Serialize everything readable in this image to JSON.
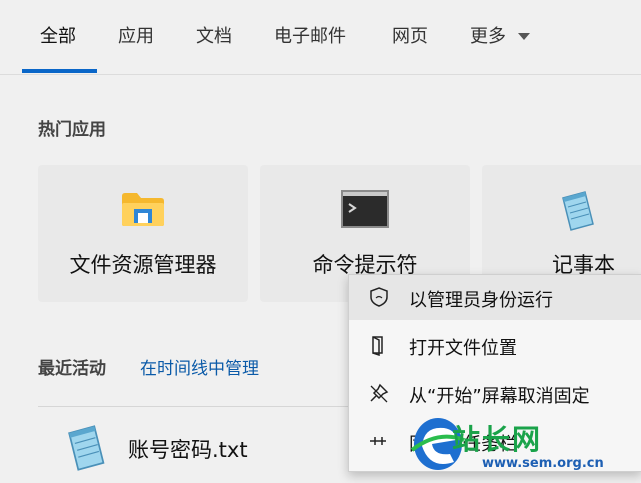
{
  "tabs": [
    {
      "label": "全部",
      "active": true
    },
    {
      "label": "应用"
    },
    {
      "label": "文档"
    },
    {
      "label": "电子邮件"
    },
    {
      "label": "网页"
    },
    {
      "label": "更多"
    }
  ],
  "hot_apps": {
    "title": "热门应用",
    "items": [
      {
        "label": "文件资源管理器",
        "icon": "folder-icon"
      },
      {
        "label": "命令提示符",
        "icon": "terminal-icon"
      },
      {
        "label": "记事本",
        "icon": "notepad-icon"
      }
    ]
  },
  "recent": {
    "title": "最近活动",
    "manage_link": "在时间线中管理",
    "items": [
      {
        "label": "账号密码.txt",
        "icon": "notepad-icon"
      }
    ]
  },
  "context_menu": {
    "items": [
      {
        "label": "以管理员身份运行",
        "icon": "shield-icon"
      },
      {
        "label": "打开文件位置",
        "icon": "folder-open-icon"
      },
      {
        "label": "从“开始”屏幕取消固定",
        "icon": "unpin-icon"
      },
      {
        "label": "固定到任务栏",
        "icon": "pin-icon"
      }
    ]
  },
  "watermark": {
    "text": "站长网",
    "url": "www.sem.org.cn"
  },
  "colors": {
    "accent": "#0a66c8",
    "link": "#0a5aa8"
  }
}
